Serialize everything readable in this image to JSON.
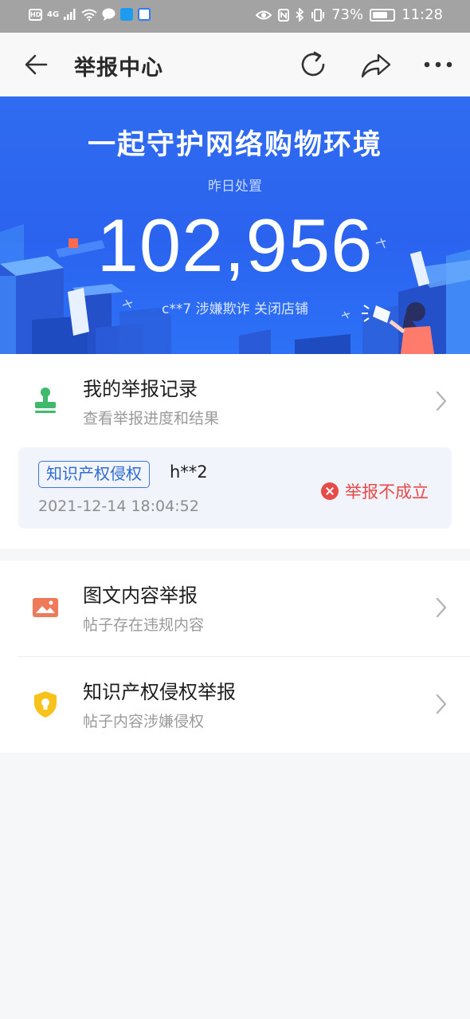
{
  "status_bar": {
    "network": "4G",
    "battery": "73%",
    "time": "11:28"
  },
  "header": {
    "title": "举报中心"
  },
  "banner": {
    "slogan": "一起守护网络购物环境",
    "subtitle": "昨日处置",
    "count": "102,956",
    "ticker": "c**7 涉嫌欺诈 关闭店铺"
  },
  "my_records": {
    "title": "我的举报记录",
    "subtitle": "查看举报进度和结果",
    "latest": {
      "tag": "知识产权侵权",
      "user": "h**2",
      "time": "2021-12-14 18:04:52",
      "status": "举报不成立"
    }
  },
  "report_types": [
    {
      "title": "图文内容举报",
      "subtitle": "帖子存在违规内容",
      "icon": "image-icon"
    },
    {
      "title": "知识产权侵权举报",
      "subtitle": "帖子内容涉嫌侵权",
      "icon": "shield-bulb-icon"
    }
  ],
  "colors": {
    "banner_blue": "#2b63ef",
    "tag_blue": "#2f6bcf",
    "error_red": "#e84a4a",
    "stamp_green": "#3fba6d",
    "image_orange": "#ef7a5a",
    "shield_yellow": "#f7c21c"
  }
}
